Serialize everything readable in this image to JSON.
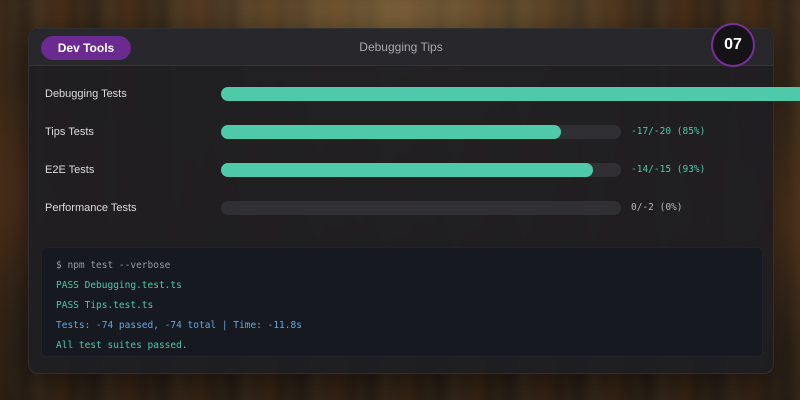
{
  "header": {
    "badge_label": "Dev Tools",
    "title": "Debugging Tips",
    "number": "07"
  },
  "colors": {
    "accent": "#4ec9aa",
    "badge": "#6b2a8f",
    "summary": "#5ea9e0"
  },
  "tests": [
    {
      "label": "Debugging Tests",
      "progress": 1.45,
      "stat": ""
    },
    {
      "label": "Tips Tests",
      "progress": 0.85,
      "stat": "-17/-20 (85%)"
    },
    {
      "label": "E2E Tests",
      "progress": 0.93,
      "stat": "-14/-15 (93%)"
    },
    {
      "label": "Performance Tests",
      "progress": 0,
      "stat": "0/-2 (0%)"
    }
  ],
  "terminal": {
    "command": "$ npm test --verbose",
    "lines": [
      "PASS Debugging.test.ts",
      "PASS Tips.test.ts"
    ],
    "summary": "Tests: -74 passed, -74 total | Time: -11.8s",
    "footer": "All test suites passed."
  }
}
